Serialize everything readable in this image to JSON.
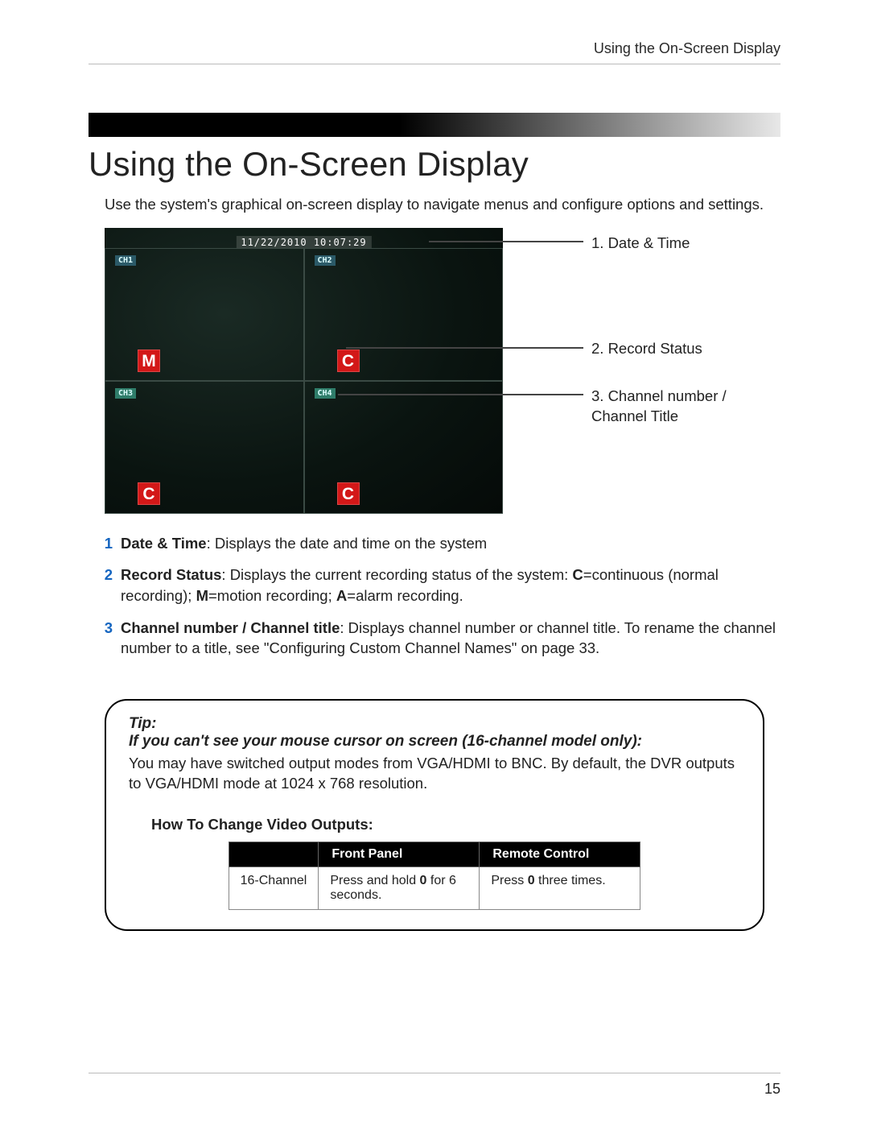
{
  "header": {
    "running_head": "Using the On-Screen Display"
  },
  "section": {
    "title": "Using the On-Screen Display",
    "intro": "Use the system's graphical on-screen display to navigate menus and configure options and settings."
  },
  "osd": {
    "timestamp": "11/22/2010 10:07:29",
    "channels": [
      {
        "label": "CH1",
        "record": "M"
      },
      {
        "label": "CH2",
        "record": "C"
      },
      {
        "label": "CH3",
        "record": "C"
      },
      {
        "label": "CH4",
        "record": "C"
      }
    ]
  },
  "callouts": [
    "1. Date & Time",
    "2. Record Status",
    "3. Channel number / Channel Title"
  ],
  "list": [
    {
      "num": "1",
      "bold": "Date & Time",
      "rest": ": Displays the date and time on the system"
    },
    {
      "num": "2",
      "bold": "Record Status",
      "rest_a": ": Displays the current recording status of the system: ",
      "c": "C",
      "rest_b": "=continuous (normal recording); ",
      "m": "M",
      "rest_c": "=motion recording; ",
      "a": "A",
      "rest_d": "=alarm recording."
    },
    {
      "num": "3",
      "bold": "Channel number / Channel title",
      "rest": ": Displays channel number or channel title. To rename the channel number to a title, see \"Configuring Custom Channel Names\" on page 33."
    }
  ],
  "tip": {
    "title": "Tip:",
    "subtitle": "If you can't see your mouse cursor on screen (16-channel model only):",
    "body": "You may have switched output modes from VGA/HDMI to BNC. By default, the DVR outputs to VGA/HDMI mode at 1024 x 768 resolution.",
    "howto_title": "How To Change Video Outputs:",
    "table": {
      "headers": [
        "",
        "Front Panel",
        "Remote Control"
      ],
      "row": {
        "label": "16-Channel",
        "fp_a": "Press and hold ",
        "fp_b": "0",
        "fp_c": " for 6 seconds.",
        "rc_a": "Press ",
        "rc_b": "0",
        "rc_c": " three times."
      }
    }
  },
  "page_number": "15"
}
